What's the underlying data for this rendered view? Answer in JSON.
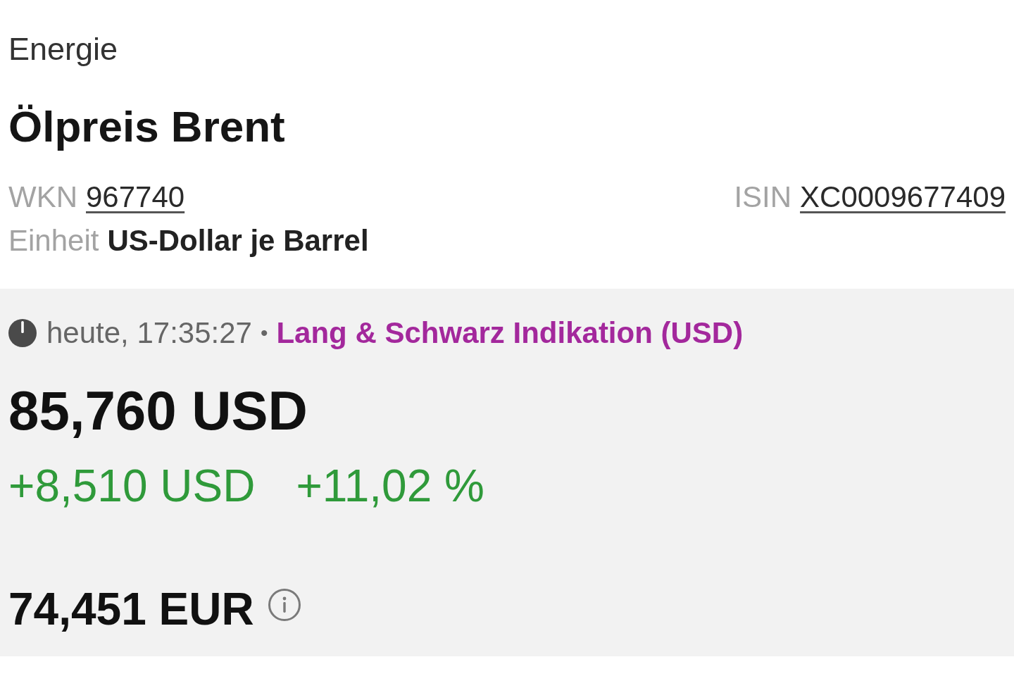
{
  "category": "Energie",
  "title": "Ölpreis Brent",
  "identifiers": [
    {
      "label": "WKN",
      "value": "967740"
    },
    {
      "label": "ISIN",
      "value": "XC0009677409"
    }
  ],
  "unit": {
    "label": "Einheit",
    "value": "US-Dollar je Barrel"
  },
  "quote": {
    "time": "heute, 17:35:27",
    "separator": "•",
    "source": "Lang & Schwarz Indikation (USD)",
    "price": "85,760 USD",
    "rising": true,
    "change_absolute": "+8,510 USD",
    "change_percent": "+11,02 %",
    "converted_price": "74,451 EUR"
  }
}
